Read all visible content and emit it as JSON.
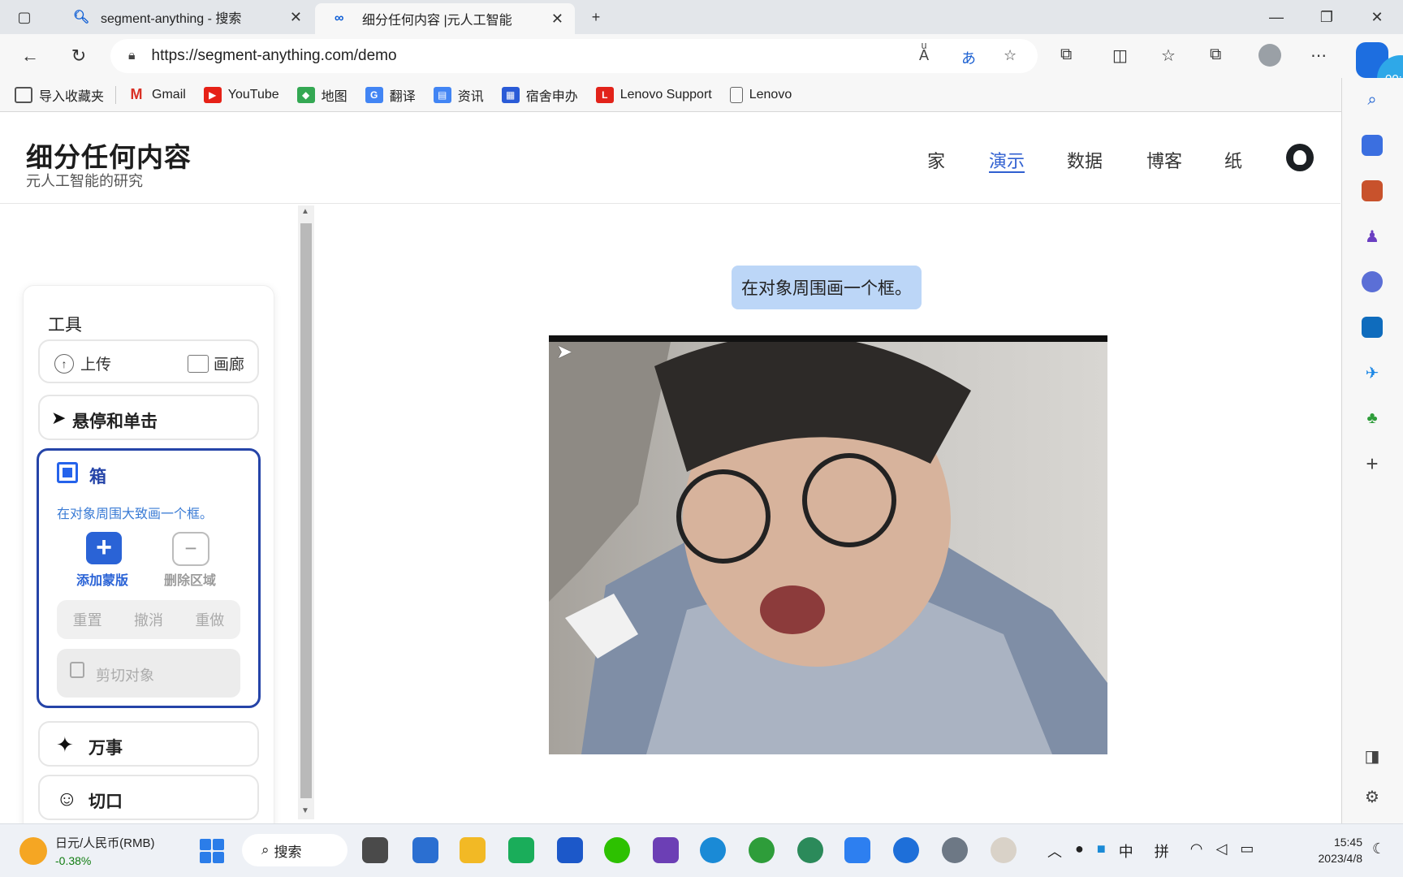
{
  "browser": {
    "tabs": [
      {
        "title": "segment-anything - 搜索",
        "icon": "search-icon",
        "active": false
      },
      {
        "title": "细分任何内容 |元人工智能",
        "icon": "meta-icon",
        "active": true
      }
    ],
    "new_tab": "+",
    "url": "https://segment-anything.com/demo",
    "bookmarks": [
      {
        "label": "导入收藏夹",
        "icon": "import-icon",
        "color": "#555555"
      },
      {
        "label": "Gmail",
        "icon": "gmail-icon",
        "color": "#d93025"
      },
      {
        "label": "YouTube",
        "icon": "youtube-icon",
        "color": "#e62117"
      },
      {
        "label": "地图",
        "icon": "maps-icon",
        "color": "#34a853"
      },
      {
        "label": "翻译",
        "icon": "translate-icon",
        "color": "#4285f4"
      },
      {
        "label": "资讯",
        "icon": "news-icon",
        "color": "#4285f4"
      },
      {
        "label": "宿舍申办",
        "icon": "dorm-icon",
        "color": "#2a5bd7"
      },
      {
        "label": "Lenovo Support",
        "icon": "lenovo-icon",
        "color": "#e2231a"
      },
      {
        "label": "Lenovo",
        "icon": "page-icon",
        "color": "#666666"
      }
    ]
  },
  "site": {
    "title": "细分任何内容",
    "subtitle": "元人工智能的研究",
    "nav": [
      "家",
      "演示",
      "数据",
      "博客",
      "纸"
    ],
    "active_nav": "演示"
  },
  "tools": {
    "heading": "工具",
    "upload": "上传",
    "gallery": "画廊",
    "hover_click": "悬停和单击",
    "box": {
      "title": "箱",
      "description": "在对象周围大致画一个框。",
      "add_mask": "添加蒙版",
      "remove_area": "删除区域",
      "reset": "重置",
      "undo": "撤消",
      "redo": "重做",
      "cut_out": "剪切对象"
    },
    "everything": "万事",
    "cutouts": "切口"
  },
  "canvas": {
    "tip": "在对象周围画一个框。"
  },
  "taskbar": {
    "ticker_name": "日元/人民币(RMB)",
    "ticker_change": "-0.38%",
    "search": "搜索",
    "ime_lang": "中",
    "ime_mode": "拼",
    "time": "15:45",
    "date": "2023/4/8"
  },
  "copilot_timer": "00:"
}
